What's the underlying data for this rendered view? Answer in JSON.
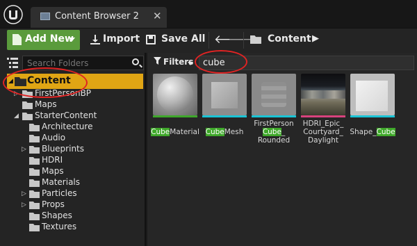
{
  "window": {
    "tab_label": "Content Browser 2",
    "close_glyph": "✕"
  },
  "toolbar": {
    "add_new_label": "Add New",
    "import_label": "Import",
    "save_all_label": "Save All",
    "back_glyph": "🡐",
    "forward_glyph": "🡒",
    "path_root": "Content",
    "path_arrow_glyph": "▶"
  },
  "sources": {
    "search_placeholder": "Search Folders",
    "tree": [
      {
        "label": "Content",
        "selected": true
      },
      {
        "label": "FirstPersonBP"
      },
      {
        "label": "Maps"
      },
      {
        "label": "StarterContent"
      },
      {
        "label": "Architecture"
      },
      {
        "label": "Audio"
      },
      {
        "label": "Blueprints"
      },
      {
        "label": "HDRI"
      },
      {
        "label": "Maps"
      },
      {
        "label": "Materials"
      },
      {
        "label": "Particles"
      },
      {
        "label": "Props"
      },
      {
        "label": "Shapes"
      },
      {
        "label": "Textures"
      }
    ],
    "expand_glyph": "▷",
    "collapse_glyph": "◢",
    "selected_expand_glyph": "◢"
  },
  "assets": {
    "filters_label": "Filters",
    "search_value": "cube",
    "items": [
      {
        "name_parts": [
          "Cube",
          "Material"
        ],
        "type_color": "#3ea72b"
      },
      {
        "name_parts": [
          "Cube",
          "Mesh"
        ],
        "type_color": "#19c4d6"
      },
      {
        "name_parts": [
          "FirstPerson",
          "Cube",
          "_",
          "Rounded"
        ],
        "type_color": "#19c4d6"
      },
      {
        "name_parts": [
          "HDRI_Epic_",
          "Courtyard_",
          "Daylight"
        ],
        "type_color": "#d8427d"
      },
      {
        "name_parts": [
          "Shape_",
          "Cube"
        ],
        "type_color": "#19c4d6"
      }
    ]
  },
  "colors": {
    "accent_selected": "#e0a514",
    "add_new_green": "#5a9b3c",
    "highlight_green": "#3fa82a",
    "annotation_red": "#e12323"
  }
}
